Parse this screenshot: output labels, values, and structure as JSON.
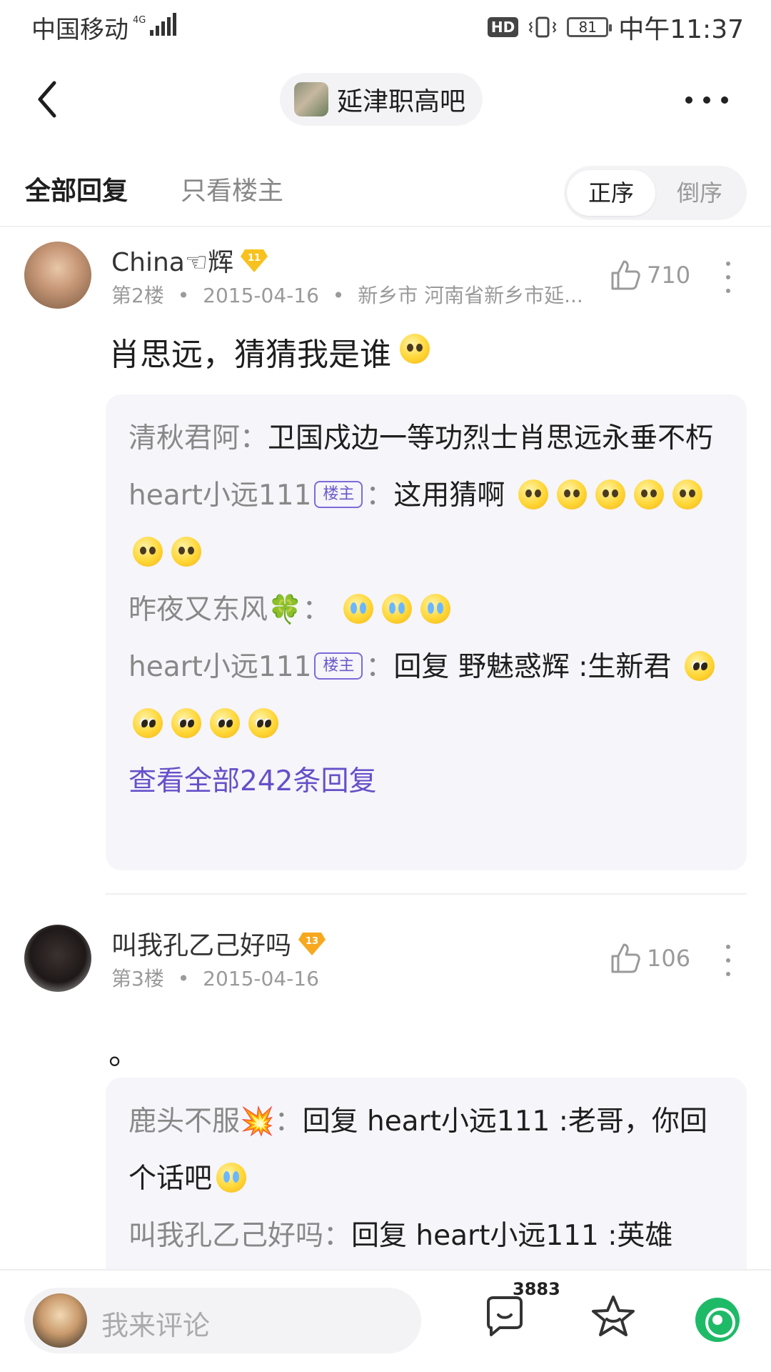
{
  "status_bar": {
    "carrier": "中国移动",
    "network": "4G",
    "hd": "HD",
    "battery": "81",
    "time": "中午11:37"
  },
  "nav": {
    "forum_name": "延津职高吧"
  },
  "tabs": {
    "all": "全部回复",
    "owner_only": "只看楼主"
  },
  "sort": {
    "asc": "正序",
    "desc": "倒序"
  },
  "posts": [
    {
      "author": "China☜辉",
      "level": "11",
      "floor": "第2楼",
      "date": "2015-04-16",
      "location": "新乡市 河南省新乡市延...",
      "likes": "710",
      "content": "肖思远，猜猜我是谁",
      "replies": [
        {
          "name": "清秋君阿",
          "text": "卫国戍边一等功烈士肖思远永垂不朽"
        },
        {
          "name": "heart小远111",
          "tag": "楼主",
          "text": "这用猜啊"
        },
        {
          "name": "昨夜又东风🍀",
          "text": ""
        },
        {
          "name": "heart小远111",
          "tag": "楼主",
          "text": "回复 野魅惑辉 :生新君"
        }
      ],
      "view_all": "查看全部242条回复"
    },
    {
      "author": "叫我孔乙己好吗",
      "level": "13",
      "floor": "第3楼",
      "date": "2015-04-16",
      "likes": "106",
      "content": "。",
      "replies": [
        {
          "name": "鹿头不服💥",
          "text": "回复 heart小远111 :老哥，你回个话吧"
        },
        {
          "name": "叫我孔乙己好吗",
          "text": "回复 heart小远111 :英雄"
        }
      ]
    }
  ],
  "bottom_bar": {
    "comment_placeholder": "我来评论",
    "reply_count": "3883"
  },
  "colors": {
    "accent": "#6650c8",
    "tag_border": "#7d6ad8",
    "share_green": "#1fba68",
    "badge_gold": "#f7c21f"
  },
  "icons": [
    "back-icon",
    "more-icon",
    "like-icon",
    "post-more-icon",
    "emoji-icon",
    "comment-icon",
    "star-icon",
    "share-icon",
    "level-badge-icon"
  ]
}
